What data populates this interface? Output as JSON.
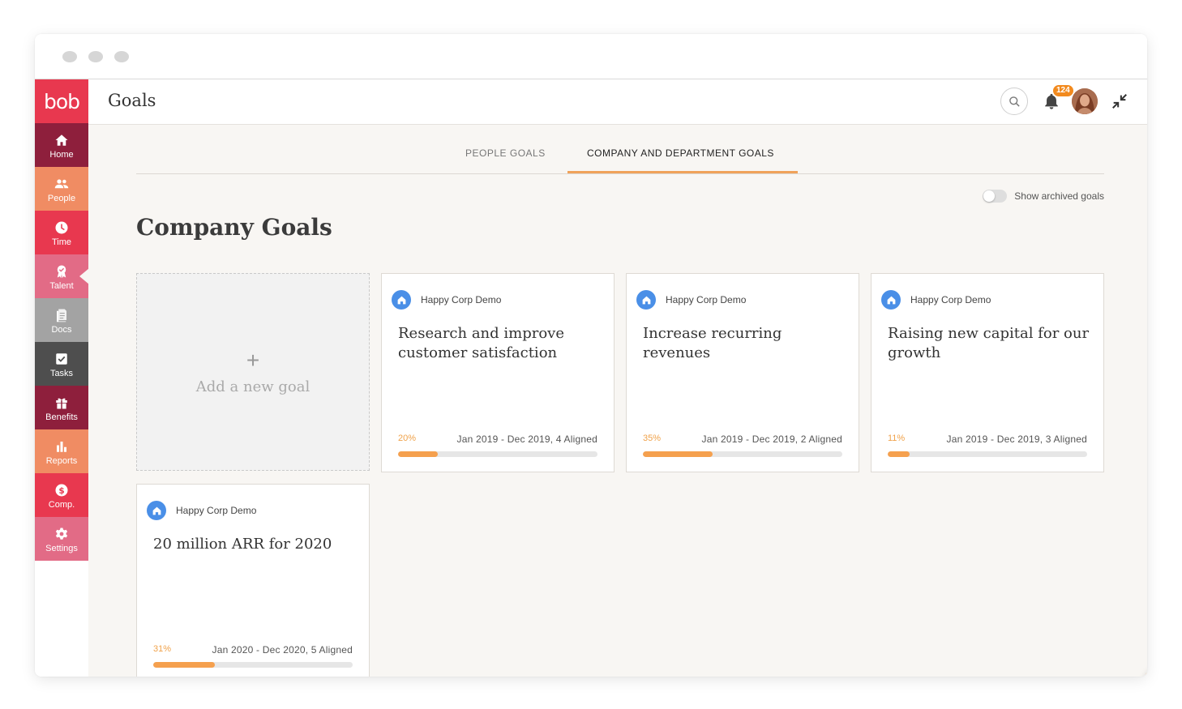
{
  "brand": {
    "logo_text": "bob",
    "color": "#e8384f"
  },
  "sidebar": {
    "items": [
      {
        "label": "Home",
        "icon": "home-icon",
        "color": "#8e1f3c"
      },
      {
        "label": "People",
        "icon": "people-icon",
        "color": "#f08c63"
      },
      {
        "label": "Time",
        "icon": "clock-icon",
        "color": "#e8384f"
      },
      {
        "label": "Talent",
        "icon": "award-icon",
        "color": "#e26b86"
      },
      {
        "label": "Docs",
        "icon": "document-icon",
        "color": "#a3a3a3"
      },
      {
        "label": "Tasks",
        "icon": "checkbox-icon",
        "color": "#4e4e4e"
      },
      {
        "label": "Benefits",
        "icon": "gift-icon",
        "color": "#8e1f3c"
      },
      {
        "label": "Reports",
        "icon": "bar-chart-icon",
        "color": "#f08c63"
      },
      {
        "label": "Comp.",
        "icon": "dollar-icon",
        "color": "#e8384f"
      },
      {
        "label": "Settings",
        "icon": "gear-icon",
        "color": "#e26b86"
      }
    ]
  },
  "header": {
    "title": "Goals",
    "notification_count": "124"
  },
  "tabs": [
    {
      "label": "PEOPLE GOALS"
    },
    {
      "label": "COMPANY AND DEPARTMENT GOALS"
    }
  ],
  "toggle": {
    "label": "Show archived goals"
  },
  "section": {
    "title": "Company Goals"
  },
  "add_card": {
    "plus": "+",
    "label": "Add a new goal"
  },
  "goals": [
    {
      "org": "Happy Corp Demo",
      "title": "Research and improve customer satisfaction",
      "percent": "20%",
      "progress": 0.2,
      "meta": "Jan 2019 - Dec 2019, 4 Aligned"
    },
    {
      "org": "Happy Corp Demo",
      "title": "Increase recurring revenues",
      "percent": "35%",
      "progress": 0.35,
      "meta": "Jan 2019 - Dec 2019, 2 Aligned"
    },
    {
      "org": "Happy Corp Demo",
      "title": "Raising new capital for our growth",
      "percent": "11%",
      "progress": 0.11,
      "meta": "Jan 2019 - Dec 2019, 3 Aligned"
    },
    {
      "org": "Happy Corp Demo",
      "title": "20 million ARR for 2020",
      "percent": "31%",
      "progress": 0.31,
      "meta": "Jan 2020 - Dec 2020, 5 Aligned"
    }
  ],
  "accent_color": "#f5a04e"
}
